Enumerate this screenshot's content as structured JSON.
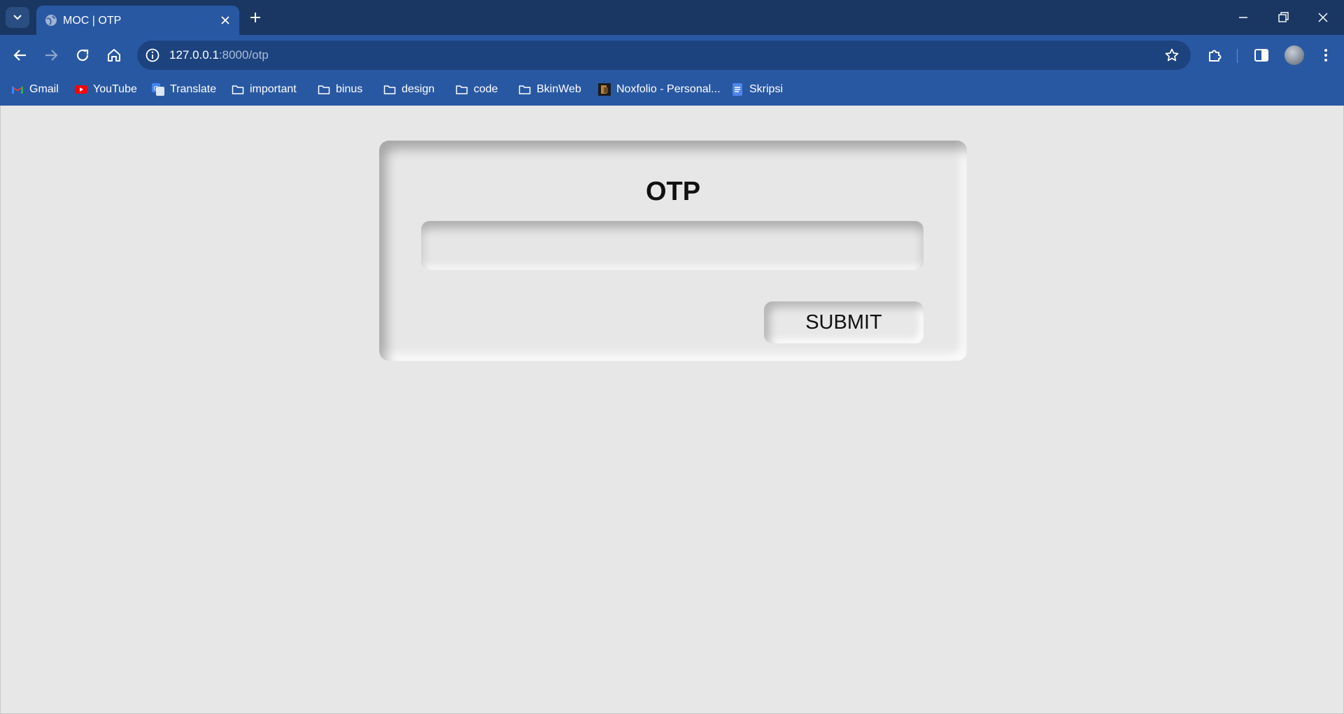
{
  "browser": {
    "tab": {
      "title": "MOC | OTP"
    },
    "address_bar": {
      "host": "127.0.0.1",
      "path": ":8000/otp"
    },
    "bookmarks": [
      {
        "label": "Gmail",
        "icon": "gmail-icon"
      },
      {
        "label": "YouTube",
        "icon": "youtube-icon"
      },
      {
        "label": "Translate",
        "icon": "translate-icon"
      },
      {
        "label": "important",
        "icon": "folder-icon"
      },
      {
        "label": "binus",
        "icon": "folder-icon"
      },
      {
        "label": "design",
        "icon": "folder-icon"
      },
      {
        "label": "code",
        "icon": "folder-icon"
      },
      {
        "label": "BkinWeb",
        "icon": "folder-icon"
      },
      {
        "label": "Noxfolio - Personal...",
        "icon": "site-favicon"
      },
      {
        "label": "Skripsi",
        "icon": "docs-icon"
      }
    ],
    "colors": {
      "frame": "#1a3764",
      "toolbar": "#2958a3",
      "omnibox": "#1d437f"
    }
  },
  "page": {
    "card": {
      "title": "OTP",
      "input": {
        "value": "",
        "placeholder": ""
      },
      "submit_label": "SUBMIT"
    },
    "colors": {
      "background": "#e7e7e7",
      "text": "#111111"
    }
  }
}
